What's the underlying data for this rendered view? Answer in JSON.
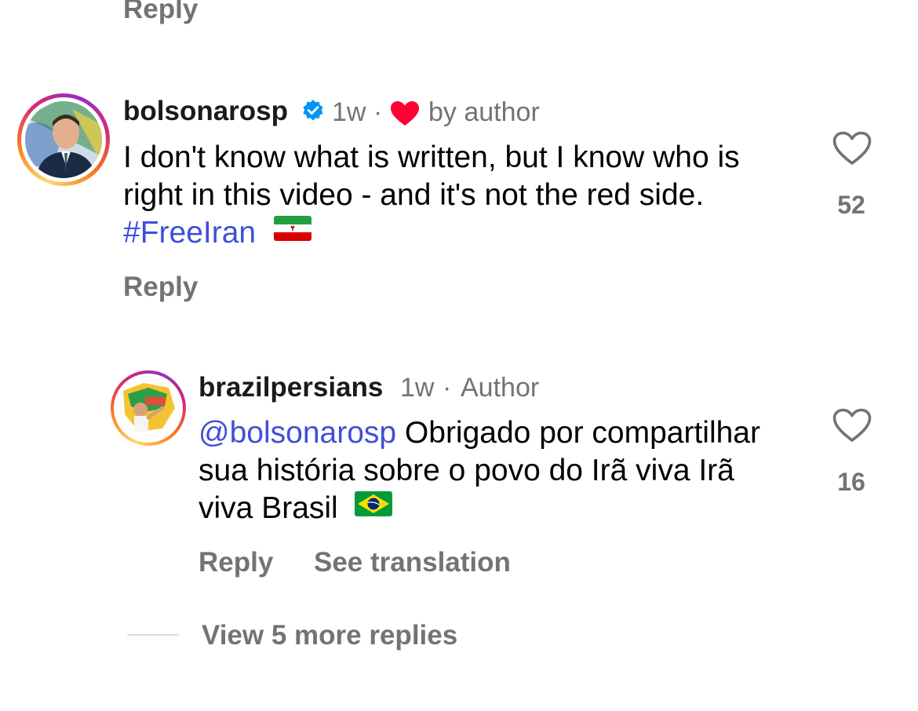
{
  "top": {
    "reply_label": "Reply"
  },
  "comments": [
    {
      "username": "bolsonarosp",
      "time": "1w",
      "separator": "·",
      "liked_by_author_label": "by author",
      "text_plain": "I don't know what is written, but I know who is right in this video - and it's not the red side.",
      "hashtag": "#FreeIran",
      "flag_icon": "iran-flag-icon",
      "verified_icon": "verified-badge-icon",
      "like_count": "52",
      "reply_label": "Reply"
    },
    {
      "username": "brazilpersians",
      "time": "1w",
      "separator": "·",
      "author_label": "Author",
      "mention": "@bolsonarosp",
      "text_plain": "Obrigado por compartilhar sua história sobre o povo do Irã viva Irã viva Brasil",
      "flag_icon": "brazil-flag-icon",
      "like_count": "16",
      "reply_label": "Reply",
      "translate_label": "See translation"
    }
  ],
  "view_more_label": "View 5 more replies",
  "colors": {
    "link_blue": "#3f4fd8",
    "muted_gray": "#737373",
    "heart_red": "#ff0033",
    "verified_blue": "#0095f6"
  }
}
